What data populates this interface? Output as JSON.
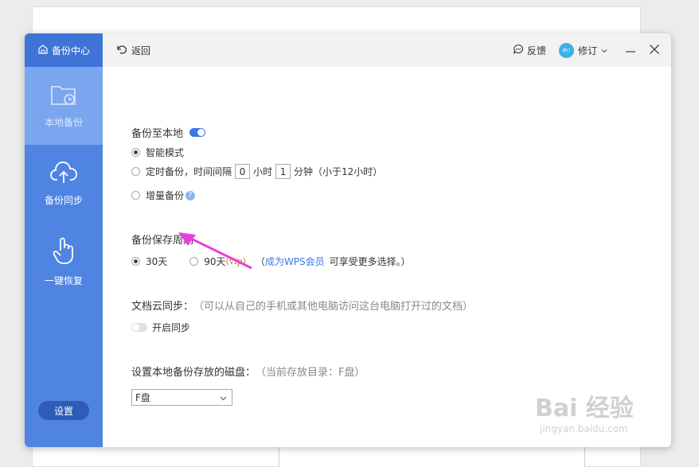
{
  "sidebar": {
    "header": "备份中心",
    "items": [
      {
        "label": "本地备份",
        "active": true
      },
      {
        "label": "备份同步",
        "active": false
      },
      {
        "label": "一键恢复",
        "active": false
      }
    ],
    "settings": "设置"
  },
  "topbar": {
    "back": "返回",
    "feedback": "反馈",
    "avatar_text": "修订",
    "user": "修订"
  },
  "local_backup": {
    "title": "备份至本地",
    "toggle_on": true,
    "mode_smart": "智能模式",
    "mode_timed_prefix": "定时备份，时间间隔",
    "hours": "0",
    "hours_unit": "小时",
    "minutes": "1",
    "minutes_unit": "分钟（小于12小时）",
    "mode_incremental": "增量备份",
    "help": "?"
  },
  "retention": {
    "title": "备份保存周期",
    "opt30": "30天",
    "opt90": "90天",
    "vip": "(vip)",
    "paren_open": "（",
    "link": "成为WPS会员",
    "suffix": "可享受更多选择。）"
  },
  "cloud_sync": {
    "title": "文档云同步：",
    "desc": "（可以从自己的手机或其他电脑访问这台电脑打开过的文档）",
    "toggle_label": "开启同步",
    "toggle_on": false
  },
  "disk": {
    "title": "设置本地备份存放的磁盘：",
    "current": "（当前存放目录：F盘）",
    "selected": "F盘"
  },
  "watermark": {
    "main": "Bai 经验",
    "sub": "jingyan.baidu.com"
  },
  "colors": {
    "sidebar": "#4f84e3",
    "accent": "#3a78e8",
    "arrow": "#e83ee0"
  }
}
